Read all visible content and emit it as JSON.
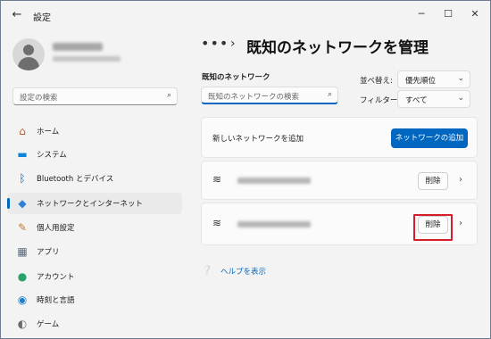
{
  "window": {
    "title": "設定"
  },
  "titlebar": {
    "back_icon": "back-arrow-icon",
    "minimize": "─",
    "maximize": "☐",
    "close": "✕"
  },
  "sidebar": {
    "search_placeholder": "設定の検索",
    "items": [
      {
        "label": "ホーム",
        "icon": "home-icon",
        "glyph": "⌂",
        "color": "#c05a2b"
      },
      {
        "label": "システム",
        "icon": "system-icon",
        "glyph": "▬",
        "color": "#0a84d4"
      },
      {
        "label": "Bluetooth とデバイス",
        "icon": "bluetooth-icon",
        "glyph": "ᛒ",
        "color": "#0067c0"
      },
      {
        "label": "ネットワークとインターネット",
        "icon": "network-icon",
        "glyph": "◆",
        "color": "#2f7fd3",
        "selected": true
      },
      {
        "label": "個人用設定",
        "icon": "brush-icon",
        "glyph": "✎",
        "color": "#c77a2a"
      },
      {
        "label": "アプリ",
        "icon": "apps-icon",
        "glyph": "▦",
        "color": "#5a6b7a"
      },
      {
        "label": "アカウント",
        "icon": "account-icon",
        "glyph": "●",
        "color": "#2aa36b"
      },
      {
        "label": "時刻と言語",
        "icon": "time-language-icon",
        "glyph": "◉",
        "color": "#1f7fc6"
      },
      {
        "label": "ゲーム",
        "icon": "game-icon",
        "glyph": "◐",
        "color": "#6b6b6b"
      }
    ]
  },
  "header": {
    "dots": "•••",
    "separator": "›",
    "title": "既知のネットワークを管理"
  },
  "known_networks": {
    "section_label": "既知のネットワーク",
    "search_placeholder": "既知のネットワークの検索",
    "sort_label": "並べ替え:",
    "sort_value": "優先順位",
    "filter_label": "フィルター:",
    "filter_value": "すべて"
  },
  "add_network": {
    "text": "新しいネットワークを追加",
    "button": "ネットワークの追加"
  },
  "networks": [
    {
      "delete_label": "削除"
    },
    {
      "delete_label": "削除"
    }
  ],
  "help": {
    "link": "ヘルプを表示"
  },
  "colors": {
    "accent": "#0067c0",
    "highlight": "#d81d2a"
  }
}
